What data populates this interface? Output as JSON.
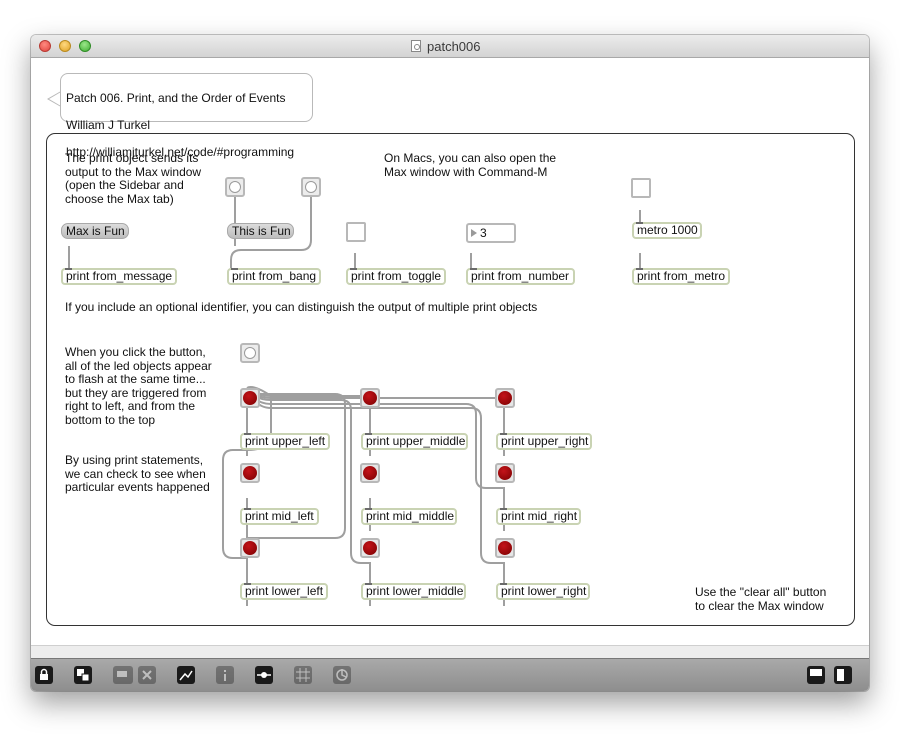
{
  "window": {
    "title": "patch006"
  },
  "header_comment": {
    "line1": "Patch 006. Print, and the Order of Events",
    "line2": "William J Turkel",
    "line3": "http://williamjturkel.net/code/#programming"
  },
  "comments": {
    "print_intro": "The print object sends its\noutput to the Max window\n(open the Sidebar and\nchoose the Max tab)",
    "mac_shortcut": "On Macs, you can also open the\nMax window with Command-M",
    "identifier": "If you include an optional identifier, you can distinguish the output of multiple print objects",
    "order_explain": "When you click the button,\nall of the led objects appear\nto flash at the same time...\nbut they are triggered from\nright to left, and from the\nbottom to the top",
    "print_statements": "By using print statements,\nwe can check to see when\nparticular events happened",
    "clear_all": "Use the \"clear all\" button\nto clear the Max window"
  },
  "messages": {
    "msg1": "Max is Fun",
    "msg2": "This is Fun"
  },
  "number_box": {
    "value": "3"
  },
  "objects": {
    "print_from_message": "print from_message",
    "print_from_bang": "print from_bang",
    "print_from_toggle": "print from_toggle",
    "print_from_number": "print from_number",
    "metro": "metro 1000",
    "print_from_metro": "print from_metro",
    "print_upper_left": "print upper_left",
    "print_upper_middle": "print upper_middle",
    "print_upper_right": "print upper_right",
    "print_mid_left": "print mid_left",
    "print_mid_middle": "print mid_middle",
    "print_mid_right": "print mid_right",
    "print_lower_left": "print lower_left",
    "print_lower_middle": "print lower_middle",
    "print_lower_right": "print lower_right"
  },
  "toolbar": {
    "icons": [
      "lock-icon",
      "presentation-icon",
      "paint-icon",
      "clear-icon",
      "debug-icon",
      "info-icon",
      "connect-icon",
      "grid-icon",
      "clear-all-icon",
      "layout-bottom-icon",
      "sidebar-icon"
    ]
  }
}
